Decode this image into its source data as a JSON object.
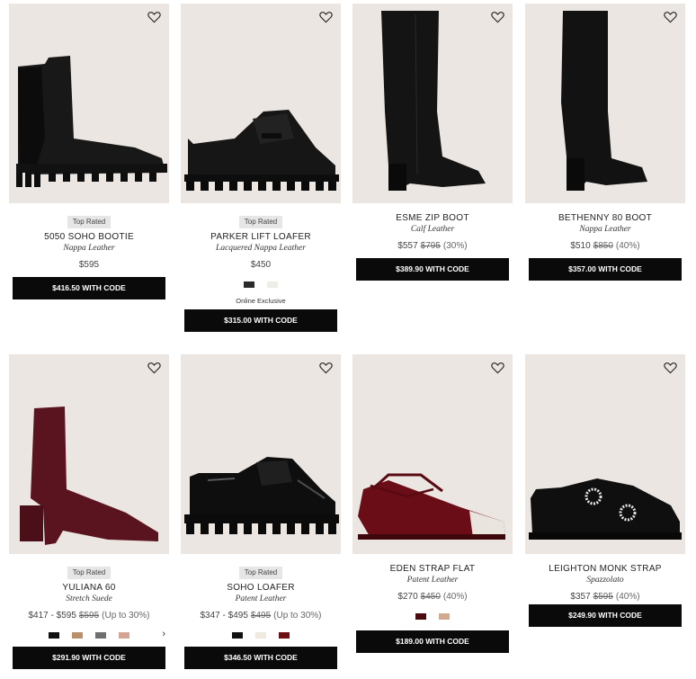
{
  "colors": {
    "card_bg": "#ece6e2",
    "button_bg": "#0a0a0a",
    "badge_bg": "#e6e6e6"
  },
  "products": [
    {
      "badge": "Top Rated",
      "name": "5050 SOHO BOOTIE",
      "material": "Nappa Leather",
      "price": "$595",
      "original_price": "",
      "discount": "",
      "swatches": [],
      "exclusive": "",
      "code_label": "$416.50 WITH CODE",
      "icon": "heart-icon"
    },
    {
      "badge": "Top Rated",
      "name": "PARKER LIFT LOAFER",
      "material": "Lacquered Nappa Leather",
      "price": "$450",
      "original_price": "",
      "discount": "",
      "swatches": [
        "#2b2b2b",
        "#efeee6"
      ],
      "exclusive": "Online Exclusive",
      "code_label": "$315.00 WITH CODE",
      "icon": "heart-icon"
    },
    {
      "badge": "",
      "name": "ESME ZIP BOOT",
      "material": "Calf Leather",
      "price": "$557",
      "original_price": "$795",
      "discount": "(30%)",
      "swatches": [],
      "exclusive": "",
      "code_label": "$389.90 WITH CODE",
      "icon": "heart-icon"
    },
    {
      "badge": "",
      "name": "BETHENNY 80 BOOT",
      "material": "Nappa Leather",
      "price": "$510",
      "original_price": "$850",
      "discount": "(40%)",
      "swatches": [],
      "exclusive": "",
      "code_label": "$357.00 WITH CODE",
      "icon": "heart-icon"
    },
    {
      "badge": "Top Rated",
      "name": "YULIANA 60",
      "material": "Stretch Suede",
      "price": "$417 - $595",
      "original_price": "$595",
      "discount": "(Up to 30%)",
      "swatches": [
        "#111111",
        "#b8906a",
        "#6f6f6f",
        "#d4a494"
      ],
      "swatch_more": "›",
      "exclusive": "",
      "code_label": "$291.90 WITH CODE",
      "icon": "heart-icon"
    },
    {
      "badge": "Top Rated",
      "name": "SOHO LOAFER",
      "material": "Patent Leather",
      "price": "$347 - $495",
      "original_price": "$495",
      "discount": "(Up to 30%)",
      "swatches": [
        "#111111",
        "#efe9df",
        "#6e0f14"
      ],
      "exclusive": "",
      "code_label": "$346.50 WITH CODE",
      "icon": "heart-icon"
    },
    {
      "badge": "",
      "name": "EDEN STRAP FLAT",
      "material": "Patent Leather",
      "price": "$270",
      "original_price": "$450",
      "discount": "(40%)",
      "swatches": [
        "#4a0a0e",
        "#d1a98c"
      ],
      "exclusive": "",
      "code_label": "$189.00 WITH CODE",
      "icon": "heart-icon"
    },
    {
      "badge": "",
      "name": "LEIGHTON MONK STRAP",
      "material": "Spazzolato",
      "price": "$357",
      "original_price": "$595",
      "discount": "(40%)",
      "swatches": [],
      "exclusive": "",
      "code_label": "$249.90 WITH CODE",
      "icon": "heart-icon"
    }
  ]
}
